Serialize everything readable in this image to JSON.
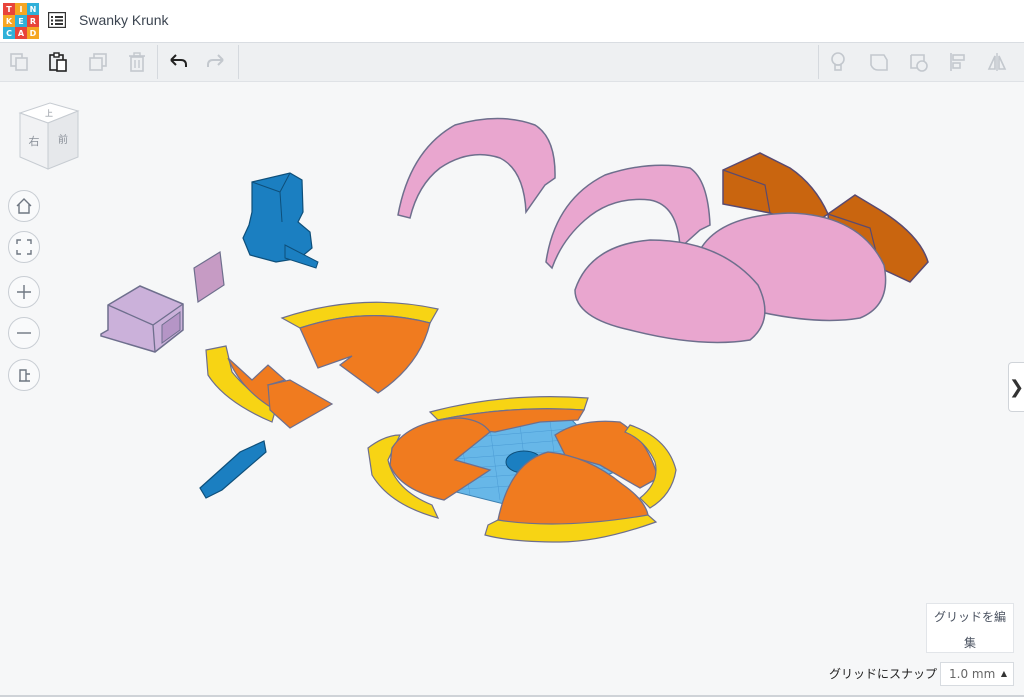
{
  "app": {
    "logo_letters": [
      "T",
      "I",
      "N",
      "K",
      "E",
      "R",
      "C",
      "A",
      "D"
    ],
    "logo_colors": [
      "#e8443a",
      "#f5a623",
      "#2fb0d9",
      "#f5a623",
      "#2fb0d9",
      "#e8443a",
      "#2fb0d9",
      "#e8443a",
      "#f5a623"
    ],
    "title": "Swanky Krunk",
    "list_icon": "list-icon"
  },
  "toolbar": {
    "left": [
      {
        "name": "copy-icon",
        "enabled": false
      },
      {
        "name": "paste-icon",
        "enabled": true
      },
      {
        "name": "duplicate-icon",
        "enabled": false
      },
      {
        "name": "delete-icon",
        "enabled": false
      },
      {
        "name": "undo-icon",
        "enabled": true
      },
      {
        "name": "redo-icon",
        "enabled": false
      }
    ],
    "right": [
      {
        "name": "lightbulb-icon",
        "enabled": false
      },
      {
        "name": "note-icon",
        "enabled": false
      },
      {
        "name": "shape-icon",
        "enabled": false
      },
      {
        "name": "align-icon",
        "enabled": false
      },
      {
        "name": "mirror-icon",
        "enabled": false
      }
    ]
  },
  "viewcube": {
    "front_label": "右",
    "side_label": "前",
    "top_label": "上"
  },
  "nav": [
    {
      "name": "home-view-icon"
    },
    {
      "name": "fit-view-icon"
    },
    {
      "name": "zoom-in-icon"
    },
    {
      "name": "zoom-out-icon"
    },
    {
      "name": "perspective-icon"
    }
  ],
  "scene": {
    "colors": {
      "pink": "#e9a6cf",
      "orange": "#f07b1f",
      "yellow": "#f7d414",
      "brown": "#c9650f",
      "blue": "#1b7fc1",
      "lavender": "#cbb1da",
      "grid_blue": "#67b7e8",
      "outline": "#5f6a8a"
    }
  },
  "right_panel_toggle": "❯",
  "grid": {
    "edit_label_line1": "グリッドを編",
    "edit_label_line2": "集",
    "snap_label": "グリッドにスナップ",
    "snap_value": "1.0 mm",
    "snap_caret": "▲"
  }
}
